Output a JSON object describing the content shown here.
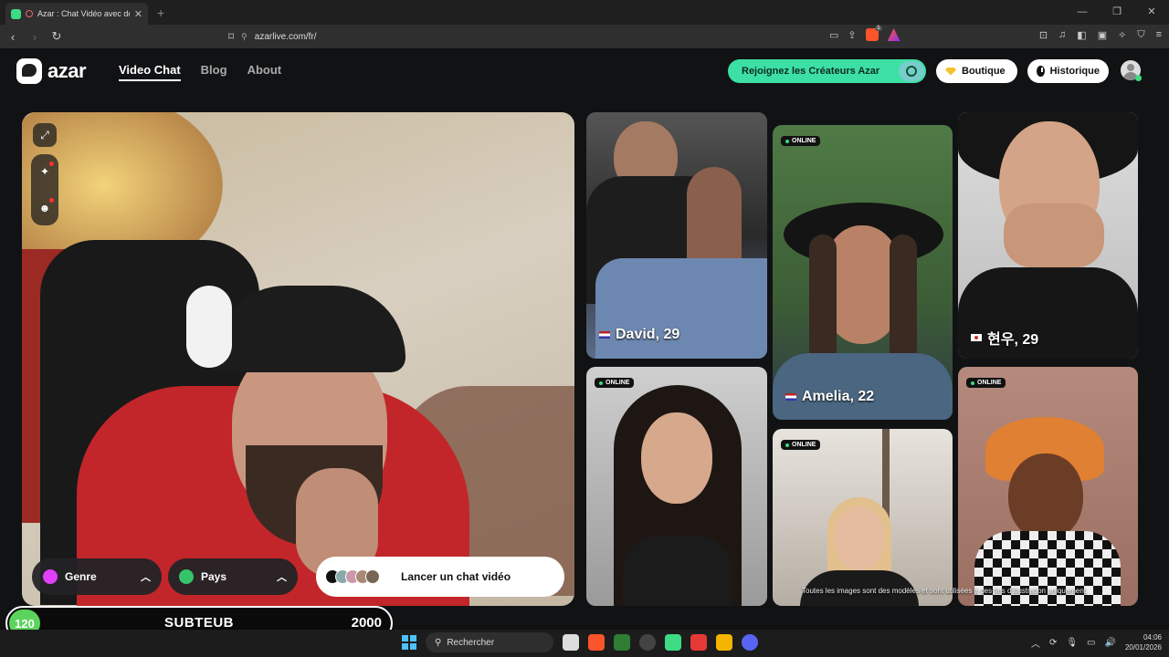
{
  "browser": {
    "tab_title": "Azar : Chat Vidéo avec de no",
    "tab_close": "✕",
    "new_tab": "+",
    "url": "azarlive.com/fr/",
    "brave_badge": "1"
  },
  "nav": {
    "logo": "azar",
    "menu": [
      "Video Chat",
      "Blog",
      "About"
    ],
    "creators_label": "Rejoignez les Créateurs Azar",
    "boutique_label": "Boutique",
    "historique_label": "Historique"
  },
  "cam": {
    "genre_label": "Genre",
    "pays_label": "Pays",
    "launch_label": "Lancer un chat vidéo"
  },
  "profiles": [
    {
      "name": "David, 29",
      "online": false
    },
    {
      "name": "Amelia, 22",
      "online": true,
      "online_label": "ONLINE"
    },
    {
      "name": "현우, 29",
      "online": false
    },
    {
      "name": "",
      "online": true,
      "online_label": "ONLINE"
    },
    {
      "name": "",
      "online": true,
      "online_label": "ONLINE"
    },
    {
      "name": "",
      "online": true,
      "online_label": "ONLINE"
    }
  ],
  "disclaimer": "Toutes les images sont des modèles et sont utilisées à des fins d'illustration uniquement.",
  "overlay": {
    "count": "120",
    "title": "SUBTEUB",
    "goal": "2000"
  },
  "taskbar": {
    "search_placeholder": "Rechercher",
    "time": "04:06",
    "date": "20/01/2026"
  },
  "colors": {
    "accent": "#3de0a4",
    "online": "#3ddc84",
    "brave": "#fb542b"
  }
}
